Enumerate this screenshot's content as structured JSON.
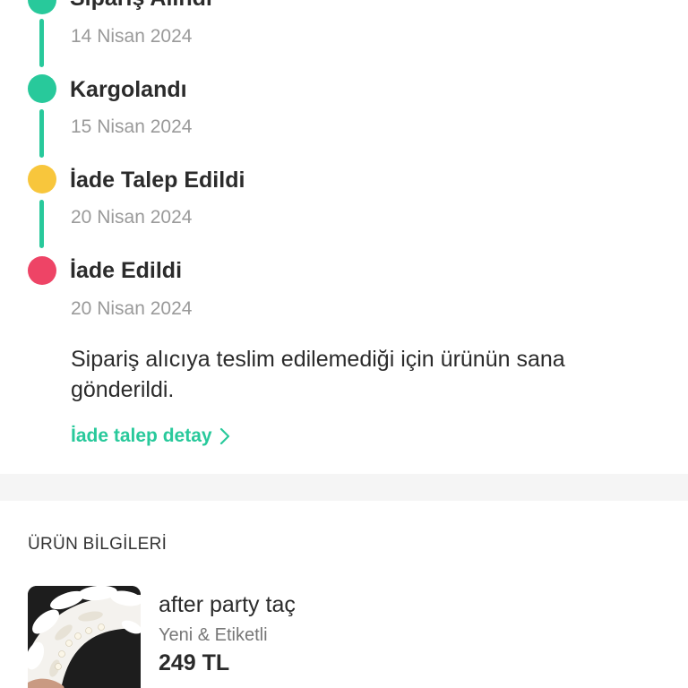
{
  "colors": {
    "accent": "#28c99b",
    "pending": "#f8c63c",
    "refunded": "#ee4466",
    "divider": "#f5f5f5"
  },
  "timeline": {
    "steps": [
      {
        "title": "Sipariş Alındı",
        "date": "14 Nisan 2024",
        "status": "done",
        "color": "#28c99b"
      },
      {
        "title": "Kargolandı",
        "date": "15 Nisan 2024",
        "status": "done",
        "color": "#28c99b"
      },
      {
        "title": "İade Talep Edildi",
        "date": "20 Nisan 2024",
        "status": "pending",
        "color": "#f8c63c"
      },
      {
        "title": "İade Edildi",
        "date": "20 Nisan 2024",
        "status": "refunded",
        "color": "#ee4466"
      }
    ],
    "note": "Sipariş alıcıya teslim edilemediği için ürünün sana gönderildi.",
    "detail_link": {
      "label": "İade talep detay",
      "icon": "chevron-right-icon"
    }
  },
  "product_section": {
    "title": "ÜRÜN BİLGİLERİ",
    "product": {
      "name": "after party taç",
      "condition": "Yeni & Etiketli",
      "price": "249 TL",
      "thumbnail_icon": "feather-crown-photo"
    }
  }
}
